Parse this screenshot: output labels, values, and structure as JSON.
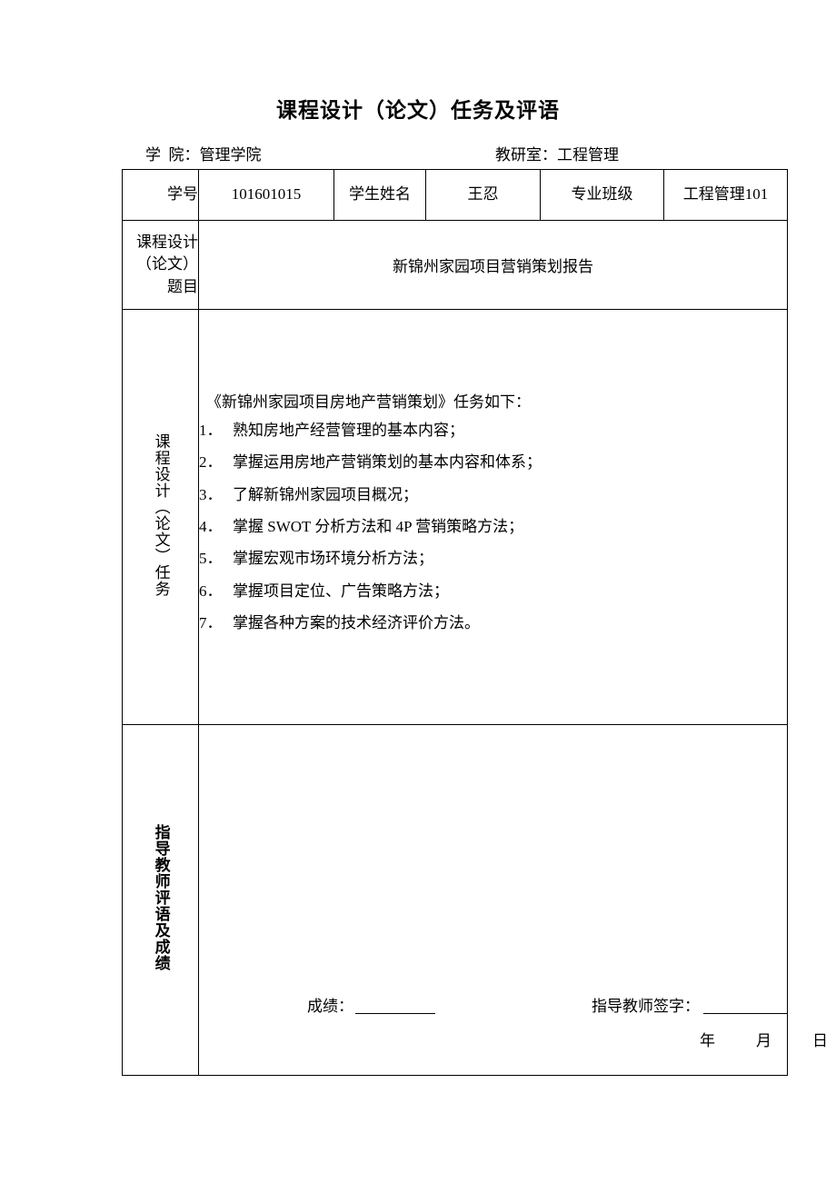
{
  "document": {
    "title": "课程设计（论文）任务及评语",
    "header": {
      "college_label": "学  院：管理学院",
      "office_label": "教研室：工程管理"
    },
    "info_row": {
      "student_id_label": "学号",
      "student_id_value": "101601015",
      "student_name_label": "学生姓名",
      "student_name_value": "王忍",
      "class_label": "专业班级",
      "class_value": "工程管理101"
    },
    "topic_row": {
      "label": "课程设计（论文）题目",
      "value": "新锦州家园项目营销策划报告"
    },
    "task_row": {
      "label": "课程设计（论文）任务",
      "intro": "《新锦州家园项目房地产营销策划》任务如下：",
      "items": [
        {
          "num": "1．",
          "text": "熟知房地产经营管理的基本内容；"
        },
        {
          "num": "2．",
          "text": "掌握运用房地产营销策划的基本内容和体系；"
        },
        {
          "num": "3．",
          "text": "了解新锦州家园项目概况；"
        },
        {
          "num": "4．",
          "text": "掌握 SWOT 分析方法和 4P 营销策略方法；"
        },
        {
          "num": "5．",
          "text": "掌握宏观市场环境分析方法；"
        },
        {
          "num": "6．",
          "text": "掌握项目定位、广告策略方法；"
        },
        {
          "num": "7．",
          "text": "掌握各种方案的技术经济评价方法。"
        }
      ]
    },
    "comment_row": {
      "label": "指导教师评语及成绩",
      "grade_label": "成绩：",
      "teacher_signature_label": "指导教师签字：",
      "date_year": "年",
      "date_month": "月",
      "date_day": "日"
    }
  }
}
